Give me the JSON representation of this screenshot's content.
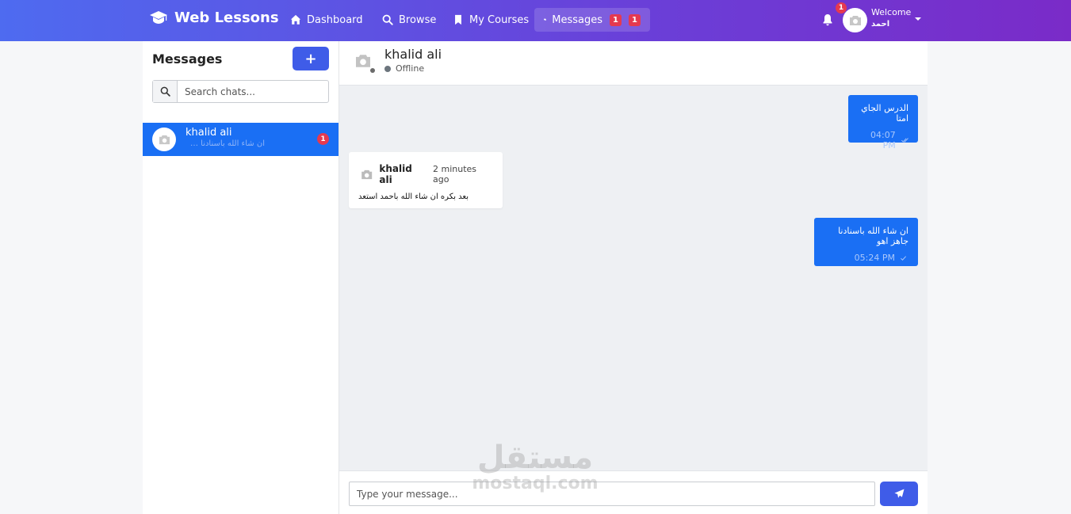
{
  "brand": {
    "name": "Web Lessons"
  },
  "nav": {
    "items": [
      {
        "label": "Dashboard",
        "icon": "home-icon"
      },
      {
        "label": "Browse",
        "icon": "search-icon"
      },
      {
        "label": "My Courses",
        "icon": "bookmark-icon"
      },
      {
        "label": "Messages",
        "icon": "comments-icon",
        "badges": [
          "1",
          "1"
        ]
      }
    ],
    "notifications_count": "1",
    "welcome": "Welcome",
    "user_name": "احمد"
  },
  "sidebar": {
    "title": "Messages",
    "new_button": "+",
    "search_placeholder": "Search chats...",
    "chats": [
      {
        "name": "khalid ali",
        "preview": "ان شاء الله باسنادنا جاهز",
        "unread": "1"
      }
    ]
  },
  "chat": {
    "contact_name": "khalid ali",
    "status": "Offline",
    "messages": [
      {
        "direction": "out",
        "text": "الدرس الجاي امتا",
        "time": "04:07 PM"
      },
      {
        "direction": "in",
        "sender": "khalid ali",
        "time": "2 minutes ago",
        "text": "بعد بكره ان شاء الله باحمد استعد"
      },
      {
        "direction": "out",
        "text": "ان شاء الله باسنادنا جاهز اهو",
        "time": "05:24 PM"
      }
    ],
    "input_placeholder": "Type your message..."
  },
  "watermark": {
    "arabic": "مستقل",
    "latin": "mostaql.com"
  },
  "colors": {
    "accent": "#3f5ce8",
    "bubble": "#1a6ff4",
    "badge": "#e53950"
  }
}
